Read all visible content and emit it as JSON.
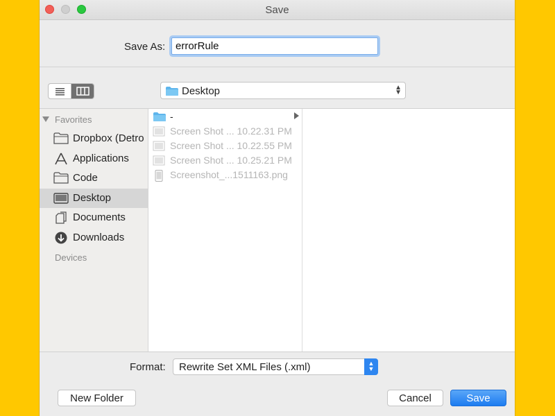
{
  "window": {
    "title": "Save"
  },
  "save_as": {
    "label": "Save As:",
    "value": "errorRule"
  },
  "toolbar": {
    "view_modes": [
      "list",
      "columns"
    ],
    "selected_view": "columns",
    "location": "Desktop"
  },
  "sidebar": {
    "sections": [
      {
        "header": "Favorites",
        "items": [
          {
            "label": "Dropbox (Detro",
            "icon": "folder-icon",
            "selected": false
          },
          {
            "label": "Applications",
            "icon": "applications-icon",
            "selected": false
          },
          {
            "label": "Code",
            "icon": "folder-icon",
            "selected": false
          },
          {
            "label": "Desktop",
            "icon": "desktop-icon",
            "selected": true
          },
          {
            "label": "Documents",
            "icon": "documents-icon",
            "selected": false
          },
          {
            "label": "Downloads",
            "icon": "downloads-icon",
            "selected": false
          }
        ]
      },
      {
        "header": "Devices",
        "items": []
      }
    ]
  },
  "column1": {
    "items": [
      {
        "name": "-",
        "icon": "folder-icon",
        "enabled": true,
        "has_children": true
      },
      {
        "name": "Screen Shot ... 10.22.31 PM",
        "icon": "screenshot-file-icon",
        "enabled": false
      },
      {
        "name": "Screen Shot ... 10.22.55 PM",
        "icon": "screenshot-file-icon",
        "enabled": false
      },
      {
        "name": "Screen Shot ... 10.25.21 PM",
        "icon": "screenshot-file-icon",
        "enabled": false
      },
      {
        "name": "Screenshot_...1511163.png",
        "icon": "phone-screenshot-icon",
        "enabled": false
      }
    ]
  },
  "format": {
    "label": "Format:",
    "selected": "Rewrite Set XML Files (.xml)"
  },
  "buttons": {
    "new_folder": "New Folder",
    "cancel": "Cancel",
    "save": "Save"
  },
  "colors": {
    "background": "#FFC800",
    "accent": "#1D7CF0",
    "close": "#F25F58",
    "zoom": "#2AC840"
  }
}
